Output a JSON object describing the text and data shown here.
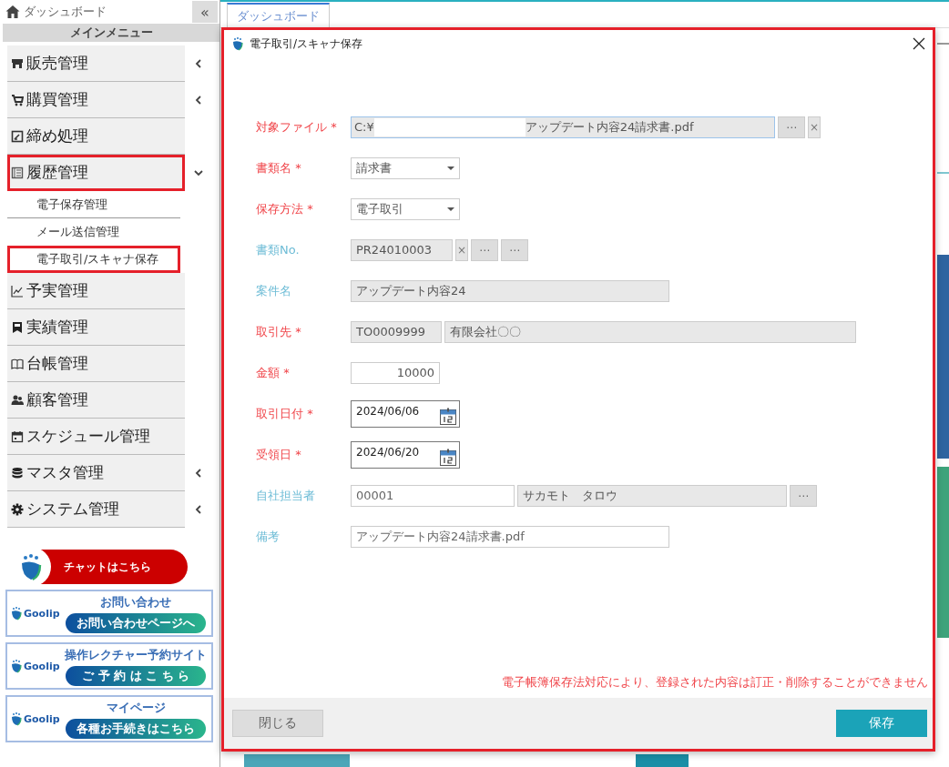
{
  "sidebar": {
    "home_label": "ダッシュボード",
    "collapse_button": "«",
    "menu_title": "メインメニュー",
    "items": [
      {
        "label": "販売管理",
        "expanded": false,
        "highlighted": false
      },
      {
        "label": "購買管理",
        "expanded": false,
        "highlighted": false
      },
      {
        "label": "締め処理",
        "highlighted": false
      },
      {
        "label": "履歴管理",
        "expanded": true,
        "highlighted": true,
        "children": [
          {
            "label": "電子保存管理",
            "highlighted": false
          },
          {
            "label": "メール送信管理",
            "highlighted": false
          },
          {
            "label": "電子取引/スキャナ保存",
            "highlighted": true
          }
        ]
      },
      {
        "label": "予実管理",
        "highlighted": false
      },
      {
        "label": "実績管理",
        "highlighted": false
      },
      {
        "label": "台帳管理",
        "highlighted": false
      },
      {
        "label": "顧客管理",
        "highlighted": false
      },
      {
        "label": "スケジュール管理",
        "highlighted": false
      },
      {
        "label": "マスタ管理",
        "expanded": false,
        "highlighted": false
      },
      {
        "label": "システム管理",
        "expanded": false,
        "highlighted": false
      }
    ],
    "chat_banner": {
      "label": "チャットはこちら"
    },
    "support_cards": [
      {
        "logo": "Goolip",
        "title": "お問い合わせ",
        "button": "お問い合わせページへ"
      },
      {
        "logo": "Goolip",
        "title": "操作レクチャー予約サイト",
        "button": "ご 予 約 は こ ち ら"
      },
      {
        "logo": "Goolip",
        "title": "マイページ",
        "button": "各種お手続きはこちら"
      }
    ]
  },
  "tabs": [
    {
      "label": "ダッシュボード",
      "selected": true
    }
  ],
  "dialog": {
    "title": "電子取引/スキャナ保存",
    "highlighted": true,
    "fields": [
      {
        "label": "対象ファイル *",
        "required": true,
        "parts": [
          {
            "kind": "file",
            "value": "C:¥",
            "value_end": "アップデート内容24請求書.pdf"
          },
          {
            "kind": "button",
            "text": "⋯"
          },
          {
            "kind": "clear",
            "text": "×"
          }
        ]
      },
      {
        "label": "書類名 *",
        "required": true,
        "parts": [
          {
            "kind": "select",
            "value": "請求書"
          }
        ]
      },
      {
        "label": "保存方法 *",
        "required": true,
        "parts": [
          {
            "kind": "select",
            "value": "電子取引"
          }
        ]
      },
      {
        "label": "書類No.",
        "required": false,
        "parts": [
          {
            "kind": "readonly",
            "value": "PR24010003"
          },
          {
            "kind": "clear",
            "text": "×"
          },
          {
            "kind": "button",
            "text": "⋯"
          },
          {
            "kind": "button",
            "text": "⋯"
          }
        ]
      },
      {
        "label": "案件名",
        "required": false,
        "parts": [
          {
            "kind": "readonly",
            "value": "アップデート内容24"
          }
        ]
      },
      {
        "label": "取引先 *",
        "required": true,
        "parts": [
          {
            "kind": "readonly",
            "value": "TO0009999"
          },
          {
            "kind": "readonly",
            "value": "有限会社〇〇"
          }
        ]
      },
      {
        "label": "金額 *",
        "required": true,
        "parts": [
          {
            "kind": "number",
            "value": "10000"
          }
        ]
      },
      {
        "label": "取引日付 *",
        "required": true,
        "parts": [
          {
            "kind": "date",
            "value": "2024/06/06"
          }
        ]
      },
      {
        "label": "受領日 *",
        "required": true,
        "parts": [
          {
            "kind": "date",
            "value": "2024/06/20"
          }
        ]
      },
      {
        "label": "自社担当者",
        "required": false,
        "parts": [
          {
            "kind": "input",
            "value": "00001"
          },
          {
            "kind": "readonly",
            "value": "サカモト　タロウ"
          },
          {
            "kind": "button",
            "text": "⋯"
          }
        ]
      },
      {
        "label": "備考",
        "required": false,
        "parts": [
          {
            "kind": "input",
            "value": "アップデート内容24請求書.pdf"
          }
        ]
      }
    ],
    "notice": "電子帳簿保存法対応により、登録された内容は訂正・削除することができません",
    "buttons": [
      {
        "label": "閉じる",
        "kind": "secondary"
      },
      {
        "label": "保存",
        "kind": "primary"
      }
    ]
  }
}
